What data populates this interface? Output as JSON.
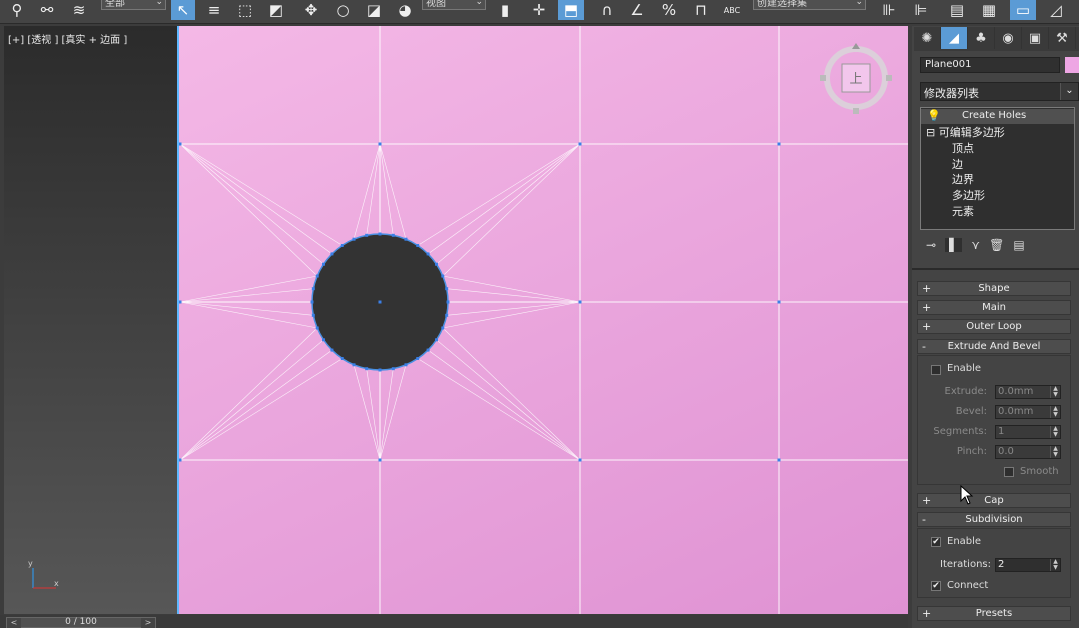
{
  "toolbar": {
    "select_filter": "全部",
    "ref_coord": "视图",
    "named_selection": "创建选择集",
    "abc_label": "ABC"
  },
  "viewport": {
    "label": "[+] [透视 ] [真实 + 边面 ]",
    "viewcube_face": "上",
    "axis_x": "x",
    "axis_y": "y"
  },
  "timeline": {
    "value": "0 / 100",
    "prev": "<",
    "next": ">"
  },
  "panel": {
    "tabs": [
      "create",
      "modify",
      "hierarchy",
      "motion",
      "display",
      "utilities"
    ],
    "object_name": "Plane001",
    "object_color": "#eea6e4",
    "modifier_list": "修改器列表",
    "stack": {
      "modifier": "Create Holes",
      "base": "可编辑多边形",
      "sublevels": [
        "顶点",
        "边",
        "边界",
        "多边形",
        "元素"
      ]
    }
  },
  "rollouts": {
    "shape": "Shape",
    "main": "Main",
    "outer_loop": "Outer Loop",
    "extrude": {
      "title": "Extrude And Bevel",
      "enable": "Enable",
      "extrude_label": "Extrude:",
      "extrude_value": "0.0mm",
      "bevel_label": "Bevel:",
      "bevel_value": "0.0mm",
      "segments_label": "Segments:",
      "segments_value": "1",
      "pinch_label": "Pinch:",
      "pinch_value": "0.0",
      "smooth": "Smooth"
    },
    "cap": "Cap",
    "subdivision": {
      "title": "Subdivision",
      "enable": "Enable",
      "iterations_label": "Iterations:",
      "iterations_value": "2",
      "connect": "Connect"
    },
    "presets": "Presets",
    "plus": "+",
    "minus": "-"
  }
}
